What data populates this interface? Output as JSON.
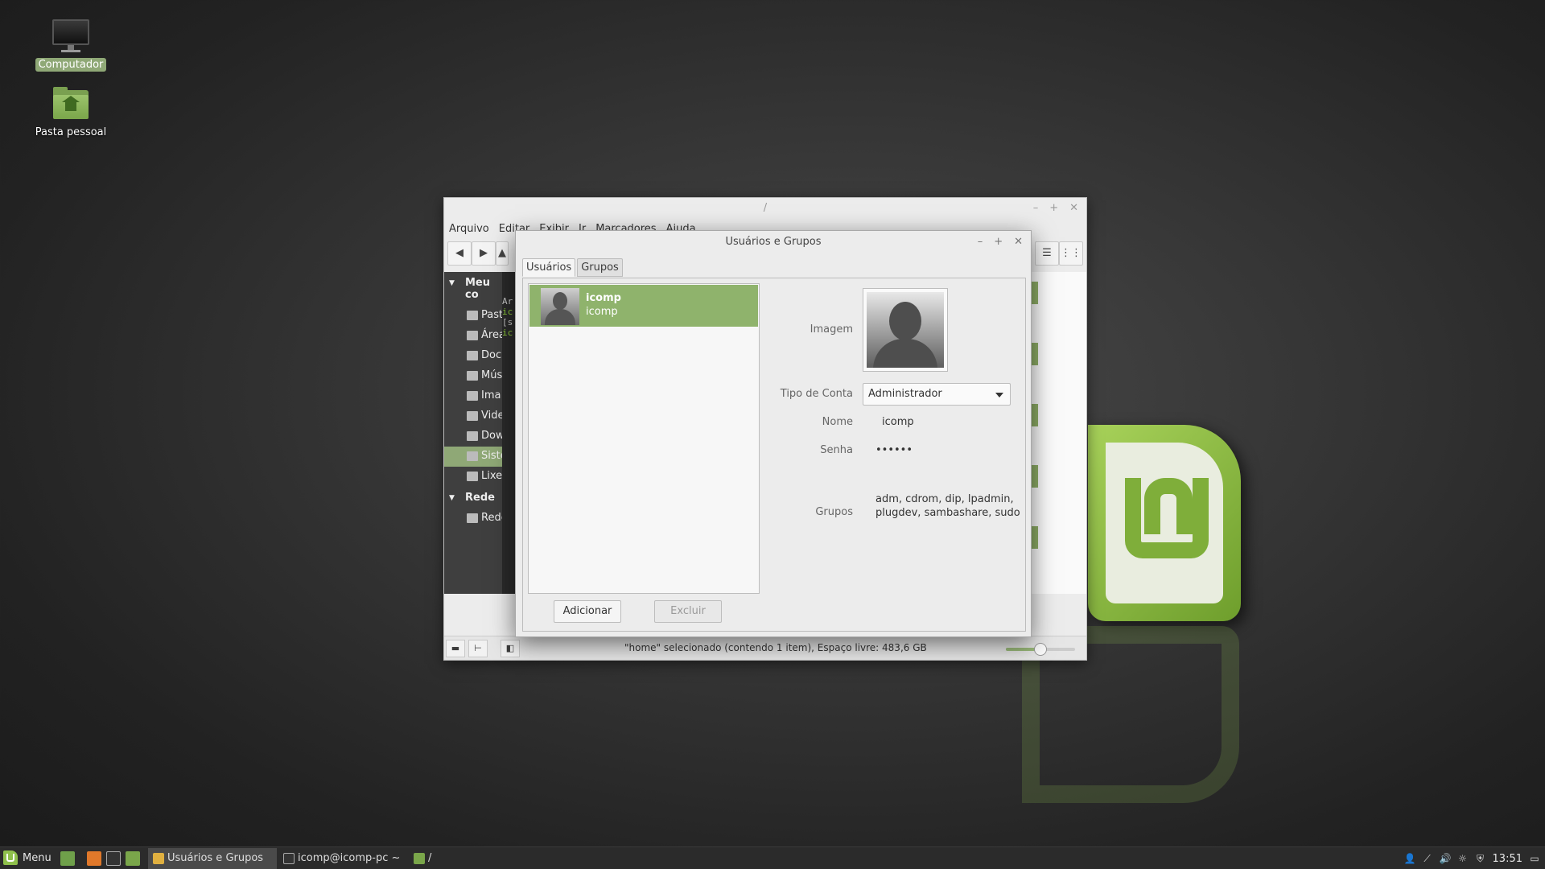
{
  "desktop": {
    "icons": [
      {
        "label": "Computador"
      },
      {
        "label": "Pasta pessoal"
      }
    ]
  },
  "file_manager": {
    "title": "/",
    "menu": [
      "Arquivo",
      "Editar",
      "Exibir",
      "Ir",
      "Marcadores",
      "Ajuda"
    ],
    "sidebar": {
      "section1": "Meu co",
      "items": [
        "Past",
        "Área",
        "Doc",
        "Mús",
        "Ima",
        "Vide",
        "Dow",
        "Siste",
        "Lixe"
      ],
      "section2": "Rede",
      "net_items": [
        "Rede"
      ]
    },
    "term_lines": [
      "Ar",
      "ic",
      "[s",
      "ic"
    ],
    "status": "\"home\" selecionado (contendo 1 item), Espaço livre: 483,6 GB",
    "zoom_level": 0.5
  },
  "dialog": {
    "title": "Usuários e Grupos",
    "tabs": [
      "Usuários",
      "Grupos"
    ],
    "users": [
      {
        "name": "icomp",
        "login": "icomp"
      }
    ],
    "buttons": {
      "add": "Adicionar",
      "delete": "Excluir"
    },
    "fields": {
      "image_label": "Imagem",
      "account_type_label": "Tipo de Conta",
      "account_type_value": "Administrador",
      "name_label": "Nome",
      "name_value": "icomp",
      "password_label": "Senha",
      "password_value": "••••••",
      "groups_label": "Grupos",
      "groups_line1": "adm, cdrom, dip, lpadmin,",
      "groups_line2": "plugdev, sambashare, sudo"
    }
  },
  "taskbar": {
    "menu_label": "Menu",
    "tasks": [
      {
        "label": "Usuários e Grupos",
        "active": true
      },
      {
        "label": "icomp@icomp-pc ~",
        "active": false
      },
      {
        "label": "/",
        "active": false
      }
    ],
    "clock": "13:51"
  },
  "colors": {
    "mint_green": "#8fb36c",
    "selection": "#8fa876"
  }
}
